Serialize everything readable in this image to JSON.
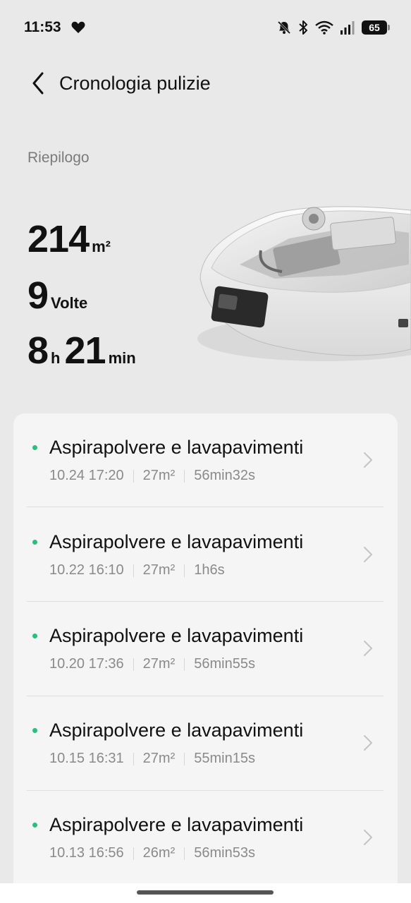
{
  "status_bar": {
    "time": "11:53",
    "battery": "65"
  },
  "header": {
    "title": "Cronologia pulizie"
  },
  "summary": {
    "label": "Riepilogo",
    "area_value": "214",
    "area_unit": "m²",
    "count_value": "9",
    "count_unit": "Volte",
    "hours_value": "8",
    "hours_unit": "h",
    "minutes_value": "21",
    "minutes_unit": "min"
  },
  "history": [
    {
      "title": "Aspirapolvere e lavapavimenti",
      "datetime": "10.24 17:20",
      "area": "27m²",
      "duration": "56min32s"
    },
    {
      "title": "Aspirapolvere e lavapavimenti",
      "datetime": "10.22 16:10",
      "area": "27m²",
      "duration": "1h6s"
    },
    {
      "title": "Aspirapolvere e lavapavimenti",
      "datetime": "10.20 17:36",
      "area": "27m²",
      "duration": "56min55s"
    },
    {
      "title": "Aspirapolvere e lavapavimenti",
      "datetime": "10.15 16:31",
      "area": "27m²",
      "duration": "55min15s"
    },
    {
      "title": "Aspirapolvere e lavapavimenti",
      "datetime": "10.13 16:56",
      "area": "26m²",
      "duration": "56min53s"
    }
  ],
  "colors": {
    "accent_dot": "#2dbd7e",
    "background": "#e9e9e9",
    "card": "#f5f5f5"
  }
}
